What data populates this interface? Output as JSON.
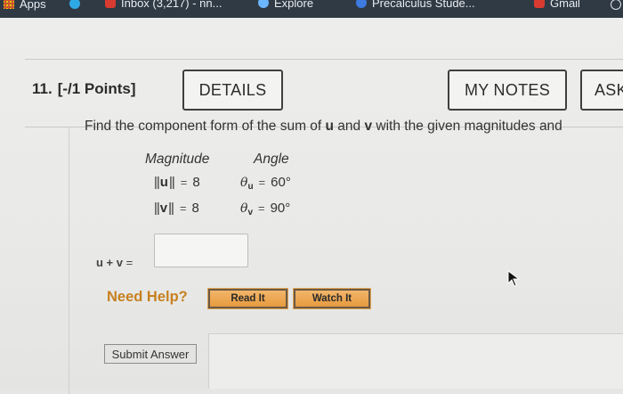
{
  "bookmarks": {
    "apps": "Apps",
    "gmail_inbox": "Inbox (3,217) - nn...",
    "explore": "Explore",
    "precalc": "Precalculus Stude...",
    "gmail": "Gmail"
  },
  "question": {
    "number": "11.",
    "points": "[-/1 Points]",
    "buttons": {
      "details": "DETAILS",
      "my_notes": "MY NOTES",
      "ask": "ASK"
    },
    "prompt": {
      "pre": "Find the component form of the sum of ",
      "u": "u",
      "mid": " and ",
      "v": "v",
      "post": " with the given magnitudes and"
    },
    "table": {
      "header_magnitude": "Magnitude",
      "header_angle": "Angle",
      "rows": [
        {
          "vector": "u",
          "magnitude": "8",
          "angle": "60°",
          "subscript": "u"
        },
        {
          "vector": "v",
          "magnitude": "8",
          "angle": "90°",
          "subscript": "v"
        }
      ]
    },
    "sum_label": {
      "lhs": "u + v",
      "eq": " ="
    },
    "answer_value": "",
    "need_help": "Need Help?",
    "read_it": "Read It",
    "watch_it": "Watch It",
    "submit": "Submit Answer"
  },
  "colors": {
    "bookmarks_bar": "#2f3a45",
    "need_help": "#c7801f",
    "help_button": "#e79a3e"
  }
}
